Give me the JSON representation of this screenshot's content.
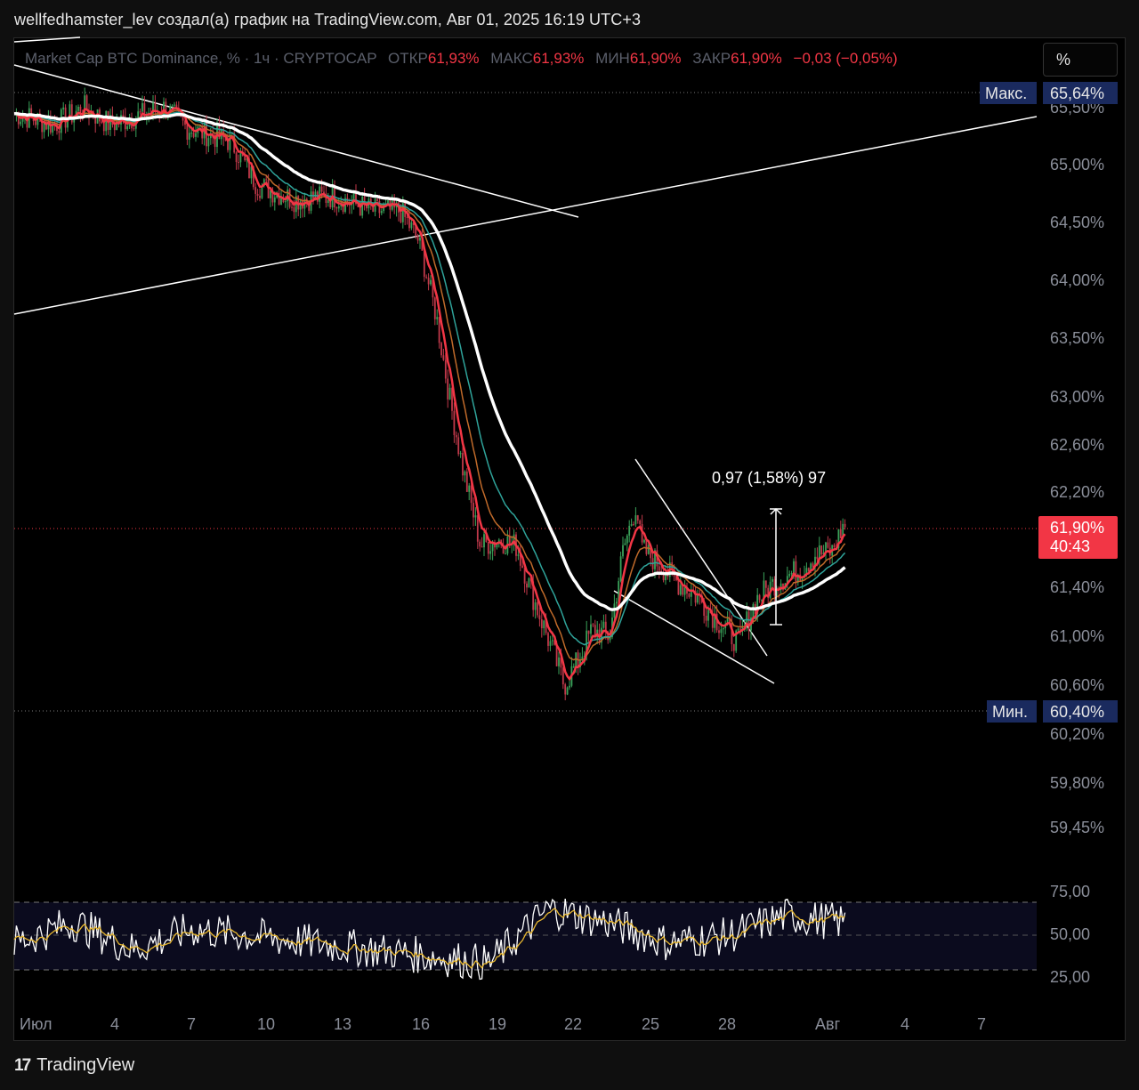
{
  "header": {
    "text": "wellfedhamster_lev создал(а) график на TradingView.com, Авг 01, 2025 16:19 UTC+3"
  },
  "legend": {
    "symbol": "Market Cap BTC Dominance, % · 1ч · CRYPTOCAP",
    "open_label": "ОТКР",
    "open": "61,93%",
    "high_label": "МАКС",
    "high": "61,93%",
    "low_label": "МИН",
    "low": "61,90%",
    "close_label": "ЗАКР",
    "close": "61,90%",
    "change": "−0,03 (−0,05%)"
  },
  "unit_button": "%",
  "max_label": {
    "tag": "Макс.",
    "value": "65,64%"
  },
  "min_label": {
    "tag": "Мин.",
    "value": "60,40%"
  },
  "price_badge": {
    "value": "61,90%",
    "countdown": "40:43"
  },
  "measure_label": "0,97 (1,58%) 97",
  "footer": {
    "brand": "TradingView"
  },
  "colors": {
    "price_red": "#f23645",
    "ema_white": "#ffffff",
    "ema_teal": "#2fa39a",
    "ema_orange": "#c06a2a",
    "rsi_line": "#ffffff",
    "rsi_signal": "#e8b830",
    "label_navy": "#1a2a5e"
  },
  "chart_data": [
    {
      "type": "line",
      "title": "Market Cap BTC Dominance, %",
      "timeframe": "1ч",
      "y_ticks": [
        "65,50%",
        "65,00%",
        "64,50%",
        "64,00%",
        "63,50%",
        "63,00%",
        "62,60%",
        "62,20%",
        "61,40%",
        "61,00%",
        "60,60%",
        "60,20%",
        "59,80%",
        "59,45%"
      ],
      "x_ticks": [
        "Июл",
        "4",
        "7",
        "10",
        "13",
        "16",
        "19",
        "22",
        "25",
        "28",
        "Авг",
        "4",
        "7"
      ],
      "ylim": [
        59.3,
        65.7
      ],
      "series": [
        {
          "name": "",
          "x": [
            "Июл",
            "4",
            "7",
            "10",
            "13",
            "16",
            "19",
            "22",
            "25",
            "28",
            "Авг"
          ],
          "values": [
            65.45,
            65.4,
            65.3,
            64.7,
            64.6,
            64.5,
            61.8,
            60.6,
            61.7,
            61.0,
            61.9
          ]
        }
      ],
      "annotations": [
        "Макс. 65,64%",
        "Мин. 60,40%",
        "0,97 (1,58%) 97"
      ]
    },
    {
      "type": "line",
      "title": "",
      "y_ticks": [
        "75,00",
        "50,00",
        "25,00"
      ],
      "ylim": [
        20,
        80
      ],
      "series": [
        {
          "name": "",
          "values": [
            45,
            60,
            40,
            55,
            50,
            45,
            40,
            35,
            30,
            70,
            60,
            45,
            50,
            65,
            60
          ]
        }
      ]
    }
  ]
}
